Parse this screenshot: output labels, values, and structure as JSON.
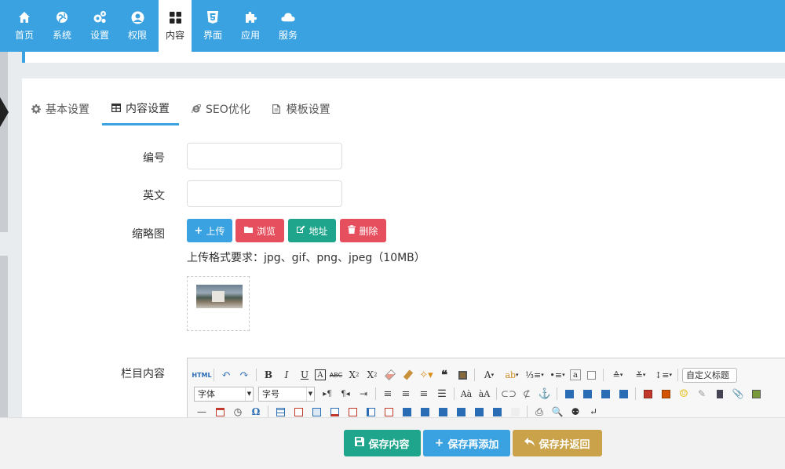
{
  "nav": {
    "items": [
      {
        "label": "首页",
        "icon": "home-icon"
      },
      {
        "label": "系统",
        "icon": "globe-icon"
      },
      {
        "label": "设置",
        "icon": "gears-icon"
      },
      {
        "label": "权限",
        "icon": "user-circle-icon"
      },
      {
        "label": "内容",
        "icon": "grid-icon",
        "active": true
      },
      {
        "label": "界面",
        "icon": "html5-icon"
      },
      {
        "label": "应用",
        "icon": "puzzle-icon"
      },
      {
        "label": "服务",
        "icon": "cloud-icon"
      }
    ]
  },
  "tabs": [
    {
      "label": "基本设置",
      "icon": "gear-icon"
    },
    {
      "label": "内容设置",
      "icon": "table-icon",
      "active": true
    },
    {
      "label": "SEO优化",
      "icon": "ie-icon"
    },
    {
      "label": "模板设置",
      "icon": "file-icon"
    }
  ],
  "form": {
    "number_label": "编号",
    "number_value": "",
    "english_label": "英文",
    "english_value": "",
    "thumbnail_label": "缩略图",
    "upload_button": "上传",
    "browse_button": "浏览",
    "address_button": "地址",
    "delete_button": "删除",
    "upload_hint": "上传格式要求：jpg、gif、png、jpeg（10MB）",
    "content_label": "栏目内容"
  },
  "editor": {
    "html_label": "HTML",
    "font_family": "字体",
    "font_size": "字号",
    "custom_title": "自定义标题"
  },
  "footer": {
    "save_content": "保存内容",
    "save_add": "保存再添加",
    "save_return": "保存并返回"
  },
  "colors": {
    "primary": "#3aa2e0",
    "danger": "#e6505e",
    "success": "#1ea58b",
    "warning": "#c9a249"
  }
}
